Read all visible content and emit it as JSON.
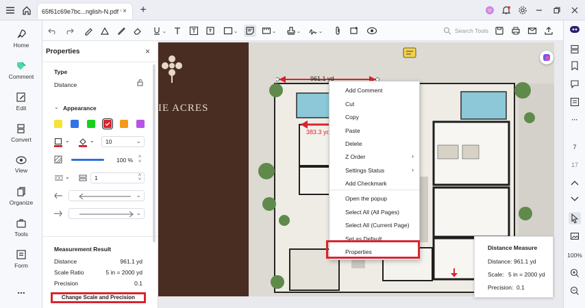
{
  "titlebar": {
    "tab_title": "65f61c69e7bc...nglish-N.pdf *",
    "tab_close": "×",
    "new_tab": "+"
  },
  "nav": {
    "items": [
      {
        "label": "Home",
        "icon": "home-rocket-icon"
      },
      {
        "label": "Comment",
        "icon": "comment-icon"
      },
      {
        "label": "Edit",
        "icon": "edit-icon"
      },
      {
        "label": "Convert",
        "icon": "convert-icon"
      },
      {
        "label": "View",
        "icon": "view-icon"
      },
      {
        "label": "Organize",
        "icon": "organize-icon"
      },
      {
        "label": "Tools",
        "icon": "tools-icon"
      },
      {
        "label": "Form",
        "icon": "form-icon"
      }
    ],
    "more": "..."
  },
  "toolbar": {
    "search_placeholder": "Search Tools"
  },
  "properties": {
    "title": "Properties",
    "close": "×",
    "type_heading": "Type",
    "type_value": "Distance",
    "appearance_heading": "Appearance",
    "colors": [
      "#f5e33a",
      "#2f73e8",
      "#16d21b",
      "#d9232e",
      "#f59a16",
      "#b654e8"
    ],
    "selected_color_index": 3,
    "stroke_color": "#d9232e",
    "fill_color": "#d9232e",
    "line_width": "10",
    "opacity_value": "100 %",
    "opacity_fraction": 1.0,
    "line_count": "1",
    "measurement_heading": "Measurement Result",
    "distance_label": "Distance",
    "distance_value": "961.1 yd",
    "scale_label": "Scale Ratio",
    "scale_value": "5 in = 2000 yd",
    "precision_label": "Precision",
    "precision_value": "0.1",
    "change_scale_button": "Change Scale and Precision"
  },
  "document": {
    "brand_text": "IE ACRES",
    "measure_label_1": "961.1 yd",
    "measure_label_2": "383.3 yd"
  },
  "context_menu": {
    "items": [
      {
        "label": "Add Comment",
        "submenu": false
      },
      {
        "label": "Cut",
        "submenu": false
      },
      {
        "label": "Copy",
        "submenu": false
      },
      {
        "label": "Paste",
        "submenu": false
      },
      {
        "label": "Delete",
        "submenu": false
      },
      {
        "label": "Z Order",
        "submenu": true
      },
      {
        "label": "Settings Status",
        "submenu": true
      },
      {
        "label": "Add Checkmark",
        "submenu": false
      },
      {
        "label": "Open the popup",
        "submenu": false
      },
      {
        "label": "Select All (All Pages)",
        "submenu": false
      },
      {
        "label": "Select All (Current Page)",
        "submenu": false
      },
      {
        "label": "Set as Default",
        "submenu": false
      },
      {
        "label": "Properties",
        "submenu": false
      }
    ],
    "arrow": "›"
  },
  "distance_card": {
    "title": "Distance Measure",
    "distance_label": "Distance:",
    "distance_value": "961.1 yd",
    "scale_label": "Scale:",
    "scale_value": "5 in = 2000 yd",
    "precision_label": "Precision:",
    "precision_value": "0.1"
  },
  "right_rail": {
    "page_number": "7",
    "page_total": "17",
    "zoom": "100%"
  },
  "accent_color": "#d9232e"
}
